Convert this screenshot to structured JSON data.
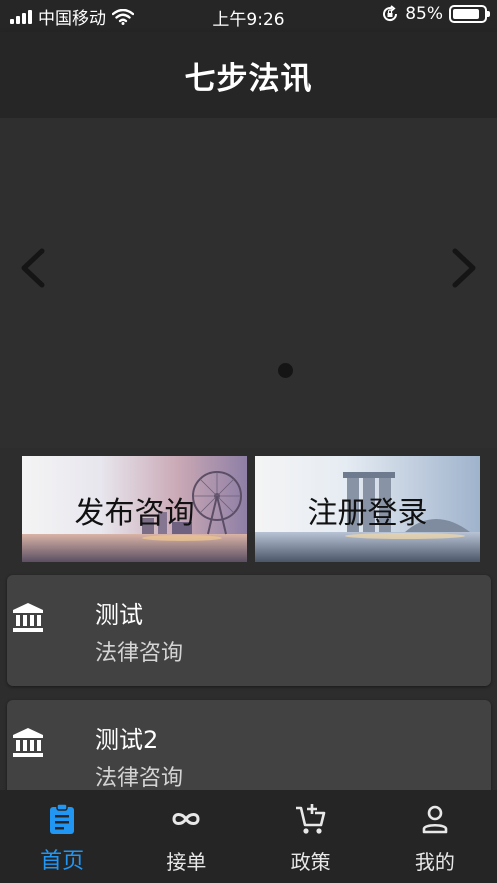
{
  "status_bar": {
    "carrier": "中国移动",
    "time": "上午9:26",
    "battery": "85%",
    "battery_level": 0.85
  },
  "nav": {
    "title": "七步法讯"
  },
  "carousel": {
    "page_count": 1,
    "active_page": 1
  },
  "banners": [
    {
      "label": "发布咨询"
    },
    {
      "label": "注册登录"
    }
  ],
  "list": [
    {
      "title": "测试",
      "subtitle": "法律咨询"
    },
    {
      "title": "测试2",
      "subtitle": "法律咨询"
    }
  ],
  "tabs": [
    {
      "label": "首页",
      "icon": "clipboard-icon",
      "active": true
    },
    {
      "label": "接单",
      "icon": "infinity-icon",
      "active": false
    },
    {
      "label": "政策",
      "icon": "cart-plus-icon",
      "active": false
    },
    {
      "label": "我的",
      "icon": "person-icon",
      "active": false
    }
  ],
  "colors": {
    "accent": "#2196f3",
    "background": "#2d2d2d",
    "card": "#424242",
    "bar": "#262626"
  }
}
